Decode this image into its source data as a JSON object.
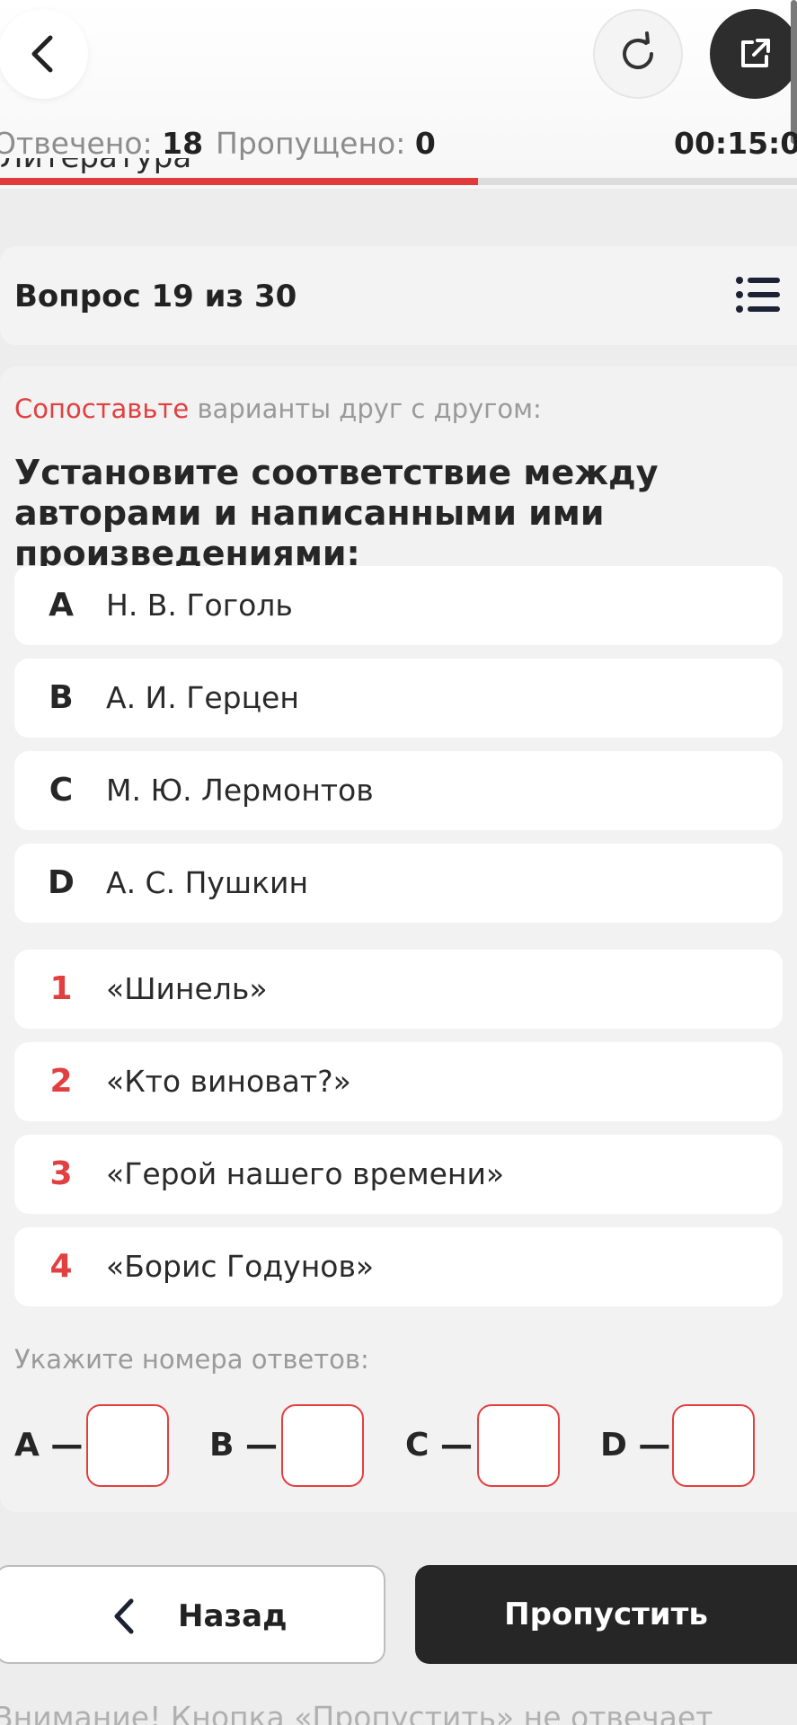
{
  "header": {
    "stats": {
      "answered_label": "Отвечено:",
      "answered_value": "18",
      "skipped_label": "Пропущено:",
      "skipped_value": "0",
      "timer": "00:15:0"
    },
    "subject_peek": "Литература",
    "progress": {
      "value": 0.6,
      "fill_color": "#e03a3a"
    },
    "icons": {
      "back": "chevron-left-icon",
      "reload": "reload-icon",
      "external": "external-link-icon"
    }
  },
  "question_header": {
    "counter": "Вопрос 19 из 30",
    "list_icon": "list-icon"
  },
  "question": {
    "instruction_accent": "Сопоставьте",
    "instruction_rest": " варианты друг с другом:",
    "text": "Установите соответствие между авторами и написанными ими произведениями:",
    "left_options": [
      {
        "key": "A",
        "text": "Н. В. Гоголь"
      },
      {
        "key": "B",
        "text": "А. И. Герцен"
      },
      {
        "key": "C",
        "text": "М. Ю. Лермонтов"
      },
      {
        "key": "D",
        "text": "А. С. Пушкин"
      }
    ],
    "right_options": [
      {
        "key": "1",
        "text": "«Шинель»"
      },
      {
        "key": "2",
        "text": "«Кто виноват?»"
      },
      {
        "key": "3",
        "text": "«Герой нашего времени»"
      },
      {
        "key": "4",
        "text": "«Борис Годунов»"
      }
    ],
    "answers_label": "Укажите номера ответов:",
    "answer_fields": [
      {
        "label": "A —",
        "value": ""
      },
      {
        "label": "B —",
        "value": ""
      },
      {
        "label": "C —",
        "value": ""
      },
      {
        "label": "D —",
        "value": ""
      }
    ]
  },
  "buttons": {
    "back_label": "Назад",
    "skip_label": "Пропустить"
  },
  "warning": "Внимание! Кнопка «Пропустить» не отвечает",
  "colors": {
    "accent": "#e24040",
    "dark_button": "#262626",
    "background": "#ededed"
  }
}
